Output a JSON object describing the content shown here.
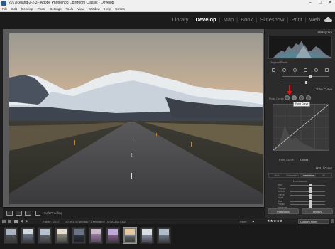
{
  "window": {
    "title": "2017Iceland-2-2-3 - Adobe Photoshop Lightroom Classic - Develop",
    "minimize": "–",
    "maximize": "□",
    "close": "✕"
  },
  "menu": [
    "File",
    "Edit",
    "Develop",
    "Photo",
    "Settings",
    "Tools",
    "View",
    "Window",
    "Help",
    "Scripts"
  ],
  "modules": [
    "Library",
    "Develop",
    "Map",
    "Book",
    "Slideshow",
    "Print",
    "Web"
  ],
  "active_module": "Develop",
  "right_panel": {
    "histogram": {
      "title": "Histogram",
      "original_photo_label": "Original Photo"
    },
    "tone_curve": {
      "title": "Tone Curve",
      "region_label": "Point Curve",
      "channel_label": "Point Curve",
      "channel_value": "Linear",
      "tooltip": "Point Curve",
      "highlight_color": "#e01515"
    },
    "hsl": {
      "header": "HSL / Color",
      "tabs": [
        "Hue",
        "Saturation",
        "Luminance",
        "All"
      ],
      "active_tab": "Luminance",
      "sub_header": "Luminance",
      "rows": [
        "Red",
        "Orange",
        "Yellow",
        "Green",
        "Aqua",
        "Blue",
        "Purple",
        "Magenta"
      ]
    },
    "buttons": {
      "previous": "Previous",
      "reset": "Reset"
    }
  },
  "toolbar": {
    "soft_proofing": "Soft Proofing"
  },
  "filmstrip": {
    "source": "Folder : 2017",
    "count_text": "10 of 1757 photos / 1 selected / _M7A1144.CR2",
    "filter_label": "Filter :",
    "stars": "★★★★★",
    "custom_filter": "Custom Filter"
  }
}
